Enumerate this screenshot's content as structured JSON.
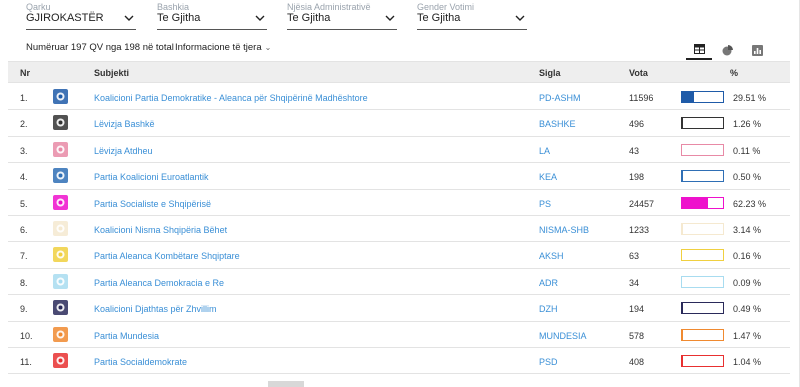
{
  "filters": [
    {
      "label": "Qarku",
      "value": "GJIROKASTËR"
    },
    {
      "label": "Bashkia",
      "value": "Te Gjitha"
    },
    {
      "label": "Njësia Administrativë",
      "value": "Te Gjitha"
    },
    {
      "label": "Gender Votimi",
      "value": "Te Gjitha"
    }
  ],
  "counter": "Numëruar 197 QV nga 198 në total",
  "info_dropdown": "Informacione të tjera",
  "view_tabs": [
    "table-icon",
    "pie-chart-icon",
    "bar-chart-icon"
  ],
  "table": {
    "headers": {
      "nr": "Nr",
      "subjekti": "Subjekti",
      "sigla": "Sigla",
      "vota": "Vota",
      "pct": "%"
    },
    "rows": [
      {
        "nr": "1.",
        "subjekti": "Koalicioni Partia Demokratike - Aleanca për Shqipërinë Madhështore",
        "sigla": "PD-ASHM",
        "vota": "11596",
        "pct": "29.51 %",
        "share": 0.2951,
        "color": "#1f5ba8",
        "logo_icon": "pd-logo-icon"
      },
      {
        "nr": "2.",
        "subjekti": "Lëvizja Bashkë",
        "sigla": "BASHKE",
        "vota": "496",
        "pct": "1.26 %",
        "share": 0.0126,
        "color": "#333333",
        "logo_icon": "bashke-logo-icon"
      },
      {
        "nr": "3.",
        "subjekti": "Lëvizja Atdheu",
        "sigla": "LA",
        "vota": "43",
        "pct": "0.11 %",
        "share": 0.0011,
        "color": "#e88aa6",
        "logo_icon": "atdheu-logo-icon"
      },
      {
        "nr": "4.",
        "subjekti": "Partia Koalicioni Euroatlantik",
        "sigla": "KEA",
        "vota": "198",
        "pct": "0.50 %",
        "share": 0.005,
        "color": "#2f6fb5",
        "logo_icon": "kea-logo-icon"
      },
      {
        "nr": "5.",
        "subjekti": "Partia Socialiste e Shqipërisë",
        "sigla": "PS",
        "vota": "24457",
        "pct": "62.23 %",
        "share": 0.6223,
        "color": "#ee11cc",
        "logo_icon": "ps-logo-icon"
      },
      {
        "nr": "6.",
        "subjekti": "Koalicioni Nisma Shqipëria Bëhet",
        "sigla": "NISMA-SHB",
        "vota": "1233",
        "pct": "3.14 %",
        "share": 0.0314,
        "color": "#f5e9d0",
        "logo_icon": "nisma-logo-icon"
      },
      {
        "nr": "7.",
        "subjekti": "Partia Aleanca Kombëtare Shqiptare",
        "sigla": "AKSH",
        "vota": "63",
        "pct": "0.16 %",
        "share": 0.0016,
        "color": "#f0d040",
        "logo_icon": "aksh-logo-icon"
      },
      {
        "nr": "8.",
        "subjekti": "Partia Aleanca Demokracia e Re",
        "sigla": "ADR",
        "vota": "34",
        "pct": "0.09 %",
        "share": 0.0009,
        "color": "#a8dcf0",
        "logo_icon": "adr-logo-icon"
      },
      {
        "nr": "9.",
        "subjekti": "Koalicioni Djathtas për Zhvillim",
        "sigla": "DZH",
        "vota": "194",
        "pct": "0.49 %",
        "share": 0.0049,
        "color": "#2a2a5a",
        "logo_icon": "dzh-logo-icon"
      },
      {
        "nr": "10.",
        "subjekti": "Partia Mundesia",
        "sigla": "MUNDESIA",
        "vota": "578",
        "pct": "1.47 %",
        "share": 0.0147,
        "color": "#f08a30",
        "logo_icon": "mundesia-logo-icon"
      },
      {
        "nr": "11.",
        "subjekti": "Partia Socialdemokrate",
        "sigla": "PSD",
        "vota": "408",
        "pct": "1.04 %",
        "share": 0.0104,
        "color": "#e83030",
        "logo_icon": "psd-logo-icon"
      }
    ]
  }
}
